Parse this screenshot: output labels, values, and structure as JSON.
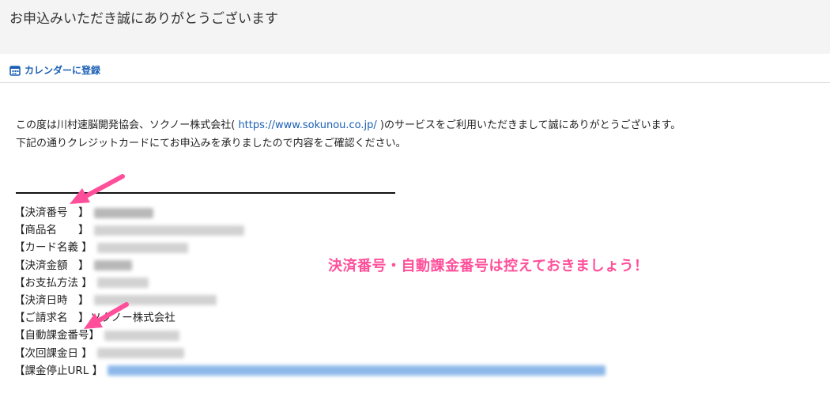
{
  "header": {
    "title": "お申込みいただき誠にありがとうございます"
  },
  "calendar": {
    "icon": "calendar-icon",
    "label": "カレンダーに登録",
    "color": "#1a5fb4"
  },
  "intro": {
    "line1_before": "この度は川村速脳開発協会、ソクノー株式会社( ",
    "url": "https://www.sokunou.co.jp/",
    "line1_after": " )のサービスをご利用いただきまして誠にありがとうございます。",
    "line2": "下記の通りクレジットカードにてお申込みを承りましたので内容をご確認ください。"
  },
  "details": {
    "payment_no": "【決済番号　】",
    "product": "【商品名　　】",
    "card_name": "【カード名義 】",
    "amount": "【決済金額　】",
    "method": "【お支払方法 】",
    "datetime": "【決済日時　】",
    "billing": "【ご請求名　】",
    "billing_value": "ソクノー株式会社",
    "auto_no": "【自動課金番号】",
    "next_date": "【次回課金日 】",
    "stop_url": "【課金停止URL 】"
  },
  "callout": {
    "text": "決済番号・自動課金番号は控えておきましょう！",
    "color": "#ff4f9a"
  }
}
